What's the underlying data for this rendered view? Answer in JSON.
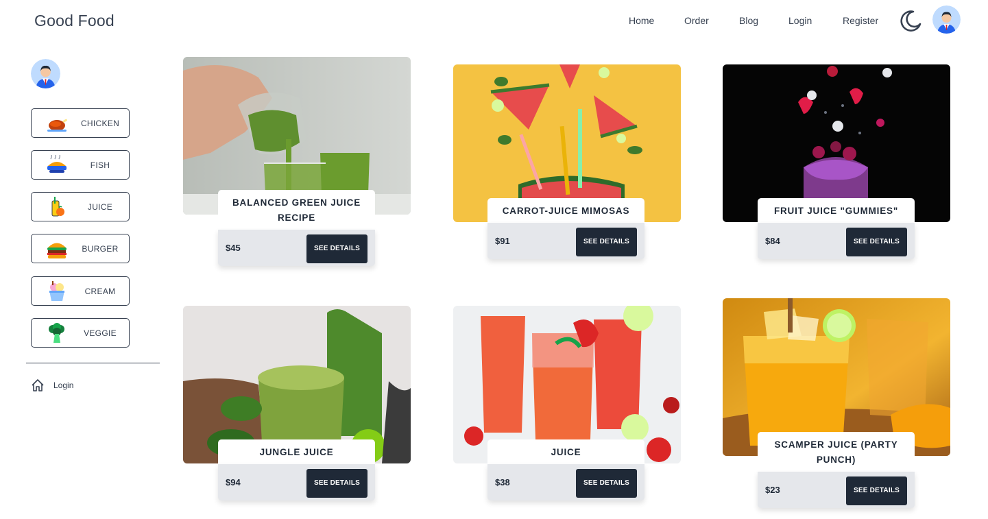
{
  "header": {
    "brand": "Good Food",
    "nav": [
      "Home",
      "Order",
      "Blog",
      "Login",
      "Register"
    ]
  },
  "icons": {
    "theme_toggle": "moon-icon",
    "avatar": "user-avatar-icon",
    "login": "home-icon"
  },
  "sidebar": {
    "categories": [
      {
        "label": "CHICKEN",
        "icon": "roast-chicken-icon"
      },
      {
        "label": "FISH",
        "icon": "fish-dish-icon"
      },
      {
        "label": "JUICE",
        "icon": "juice-icon"
      },
      {
        "label": "BURGER",
        "icon": "burger-icon"
      },
      {
        "label": "CREAM",
        "icon": "ice-cream-icon"
      },
      {
        "label": "VEGGIE",
        "icon": "broccoli-icon"
      }
    ],
    "login_label": "Login"
  },
  "products": [
    {
      "title": "BALANCED GREEN JUICE RECIPE",
      "price": "$45",
      "button": "SEE DETAILS"
    },
    {
      "title": "CARROT-JUICE MIMOSAS",
      "price": "$91",
      "button": "SEE DETAILS"
    },
    {
      "title": "FRUIT JUICE \"GUMMIES\"",
      "price": "$84",
      "button": "SEE DETAILS"
    },
    {
      "title": "JUNGLE JUICE",
      "price": "$94",
      "button": "SEE DETAILS"
    },
    {
      "title": "JUICE",
      "price": "$38",
      "button": "SEE DETAILS"
    },
    {
      "title": "SCAMPER JUICE (PARTY PUNCH)",
      "price": "$23",
      "button": "SEE DETAILS"
    }
  ],
  "colors": {
    "text": "#374151",
    "button": "#1f2937",
    "card_footer": "#e5e7eb",
    "avatar_bg": "#bfdbfe"
  }
}
